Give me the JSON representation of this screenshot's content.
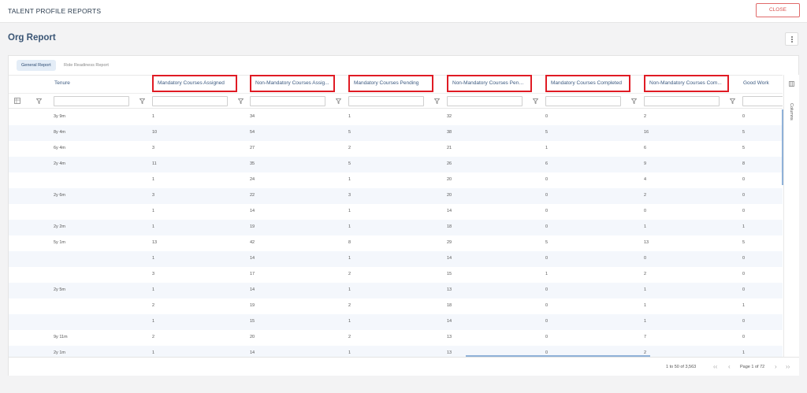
{
  "app": {
    "title": "TALENT PROFILE REPORTS",
    "close_label": "CLOSE"
  },
  "page": {
    "title": "Org Report"
  },
  "tabs": [
    {
      "label": "General Report",
      "active": true
    },
    {
      "label": "Role Readiness Report",
      "active": false
    }
  ],
  "columns": [
    {
      "label": "Tenure",
      "highlighted": false
    },
    {
      "label": "Mandatory Courses Assigned",
      "highlighted": true
    },
    {
      "label": "Non-Mandatory Courses Assig...",
      "highlighted": true
    },
    {
      "label": "Mandatory Courses Pending",
      "highlighted": true
    },
    {
      "label": "Non-Mandatory Courses Pendi...",
      "highlighted": true
    },
    {
      "label": "Mandatory Courses Completed",
      "highlighted": true
    },
    {
      "label": "Non-Mandatory Courses Com...",
      "highlighted": true
    },
    {
      "label": "Good Work",
      "highlighted": false
    }
  ],
  "rows": [
    [
      "3y 9m",
      "1",
      "34",
      "1",
      "32",
      "0",
      "2",
      "0"
    ],
    [
      "8y 4m",
      "10",
      "54",
      "5",
      "38",
      "5",
      "16",
      "5"
    ],
    [
      "6y 4m",
      "3",
      "27",
      "2",
      "21",
      "1",
      "6",
      "5"
    ],
    [
      "2y 4m",
      "11",
      "35",
      "5",
      "26",
      "6",
      "9",
      "8"
    ],
    [
      "",
      "1",
      "24",
      "1",
      "20",
      "0",
      "4",
      "0"
    ],
    [
      "2y 6m",
      "3",
      "22",
      "3",
      "20",
      "0",
      "2",
      "0"
    ],
    [
      "",
      "1",
      "14",
      "1",
      "14",
      "0",
      "0",
      "0"
    ],
    [
      "2y 2m",
      "1",
      "19",
      "1",
      "18",
      "0",
      "1",
      "1"
    ],
    [
      "5y 1m",
      "13",
      "42",
      "8",
      "29",
      "5",
      "13",
      "5"
    ],
    [
      "",
      "1",
      "14",
      "1",
      "14",
      "0",
      "0",
      "0"
    ],
    [
      "",
      "3",
      "17",
      "2",
      "15",
      "1",
      "2",
      "0"
    ],
    [
      "2y 5m",
      "1",
      "14",
      "1",
      "13",
      "0",
      "1",
      "0"
    ],
    [
      "",
      "2",
      "19",
      "2",
      "18",
      "0",
      "1",
      "1"
    ],
    [
      "",
      "1",
      "15",
      "1",
      "14",
      "0",
      "1",
      "0"
    ],
    [
      "9y 11m",
      "2",
      "20",
      "2",
      "13",
      "0",
      "7",
      "0"
    ],
    [
      "2y 1m",
      "1",
      "14",
      "1",
      "13",
      "0",
      "2",
      "1"
    ]
  ],
  "sidebar": {
    "columns_label": "Columns"
  },
  "pagination": {
    "summary": "1 to 50 of 3,563",
    "page_text": "Page 1 of 72",
    "first": "‹‹",
    "prev": "‹",
    "next": "›",
    "last": "››"
  },
  "colors": {
    "highlight": "#e01b24",
    "accent": "#3c5a80",
    "close": "#d9534f"
  },
  "icons": {
    "filter": "filter-icon",
    "columns_toggle": "grid-icon",
    "menu": "kebab-menu-icon"
  }
}
